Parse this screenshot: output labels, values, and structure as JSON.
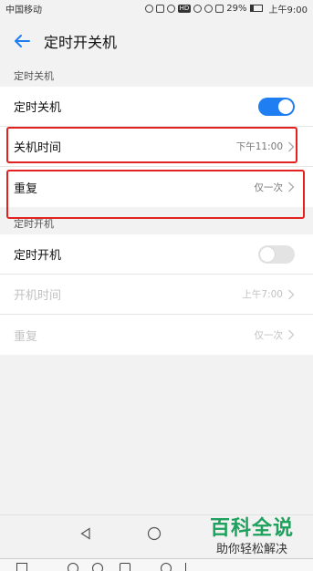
{
  "status_bar": {
    "carrier": "中国移动",
    "signal_badge": "HD",
    "battery": "29%",
    "battery_level": 0.29,
    "time": "上午9:00"
  },
  "header": {
    "title": "定时开关机",
    "back_icon": "arrow-left-icon"
  },
  "sections": {
    "shutdown": {
      "header": "定时关机",
      "toggle_label": "定时关机",
      "toggle_on": true,
      "time_label": "关机时间",
      "time_value": "下午11:00",
      "repeat_label": "重复",
      "repeat_value": "仅一次"
    },
    "startup": {
      "header": "定时开机",
      "toggle_label": "定时开机",
      "toggle_on": false,
      "time_label": "开机时间",
      "time_value": "上午7:00",
      "repeat_label": "重复",
      "repeat_value": "仅一次"
    }
  },
  "colors": {
    "accent": "#1f7ef2",
    "highlight": "#e3211f",
    "watermark": "#1ea15c"
  },
  "watermark": {
    "main": "百科全说",
    "sub": "助你轻松解决"
  }
}
